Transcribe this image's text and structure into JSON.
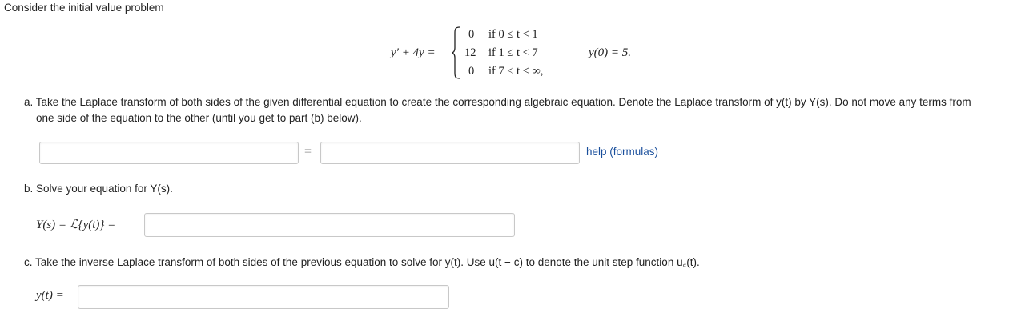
{
  "intro": "Consider the initial value problem",
  "ode": {
    "lhs": "y′ + 4y =",
    "cases": [
      {
        "value": "0",
        "condition": "if 0 ≤ t < 1"
      },
      {
        "value": "12",
        "condition": "if 1 ≤ t < 7"
      },
      {
        "value": "0",
        "condition": "if 7 ≤ t < ∞,"
      }
    ],
    "initial_condition": "y(0) = 5."
  },
  "part_a": {
    "line1": "a. Take the Laplace transform of both sides of the given differential equation to create the corresponding algebraic equation. Denote the Laplace transform of y(t) by Y(s). Do not move any terms from",
    "line2": "one side of the equation to the other (until you get to part (b) below).",
    "equals": "=",
    "help_link": "help (formulas)"
  },
  "part_b": {
    "text": "b. Solve your equation for Y(s).",
    "lhs": "Y(s) = ℒ{y(t)} ="
  },
  "part_c": {
    "text": "c. Take the inverse Laplace transform of both sides of the previous equation to solve for y(t). Use u(t − c) to denote the unit step function u꜀(t).",
    "lhs": "y(t) ="
  }
}
